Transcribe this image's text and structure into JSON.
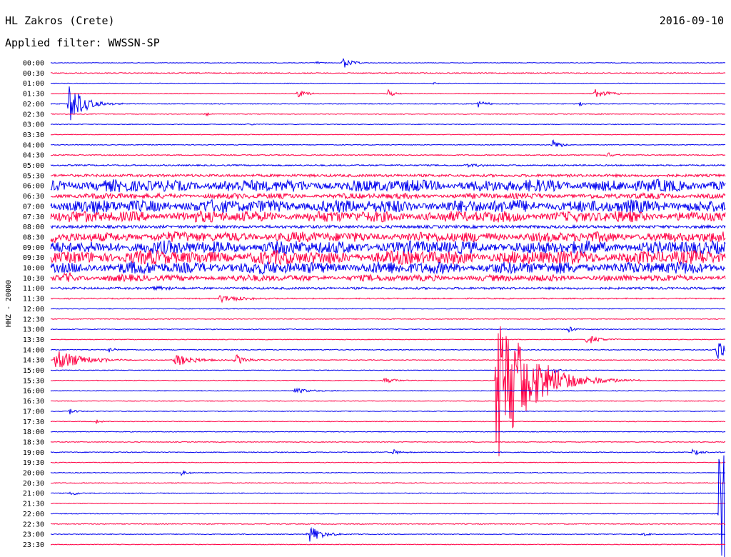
{
  "header": {
    "station": "HL Zakros (Crete)",
    "date": "2016-09-10",
    "filter": "Applied filter: WWSSN-SP"
  },
  "chart_data": {
    "type": "line",
    "title": "HL Zakros (Crete)",
    "subtitle": "Applied filter: WWSSN-SP",
    "ylabel": "HHZ - 20000",
    "colors": {
      "even_row": "#0000ee",
      "odd_row": "#ff0044"
    },
    "tick_labels": [
      "00:00",
      "00:30",
      "01:00",
      "01:30",
      "02:00",
      "02:30",
      "03:00",
      "03:30",
      "04:00",
      "04:30",
      "05:00",
      "05:30",
      "06:00",
      "06:30",
      "07:00",
      "07:30",
      "08:00",
      "08:30",
      "09:00",
      "09:30",
      "10:00",
      "10:30",
      "11:00",
      "11:30",
      "12:00",
      "12:30",
      "13:00",
      "13:30",
      "14:00",
      "14:30",
      "15:00",
      "15:30",
      "16:00",
      "16:30",
      "17:00",
      "17:30",
      "18:00",
      "18:30",
      "19:00",
      "19:30",
      "20:00",
      "20:30",
      "21:00",
      "21:30",
      "22:00",
      "22:30",
      "23:00",
      "23:30"
    ],
    "noise_level": [
      0.4,
      0.7,
      0.4,
      0.5,
      0.6,
      0.5,
      0.5,
      0.5,
      0.5,
      0.7,
      1.0,
      1.8,
      6.5,
      3.0,
      7.0,
      6.0,
      2.0,
      5.5,
      7.0,
      7.5,
      6.5,
      3.5,
      1.5,
      0.8,
      0.5,
      0.6,
      0.6,
      0.5,
      0.6,
      0.5,
      0.5,
      0.5,
      0.5,
      0.5,
      0.5,
      0.5,
      0.5,
      0.5,
      0.6,
      0.5,
      0.5,
      0.6,
      0.6,
      0.5,
      0.5,
      0.6,
      0.5,
      0.5
    ],
    "events": [
      {
        "row": 0,
        "minute": 13.0,
        "amplitude": 9,
        "duration": 0.6
      },
      {
        "row": 0,
        "minute": 11.8,
        "amplitude": 2,
        "duration": 0.5
      },
      {
        "row": 2,
        "minute": 17.0,
        "amplitude": 2,
        "duration": 0.3
      },
      {
        "row": 3,
        "minute": 11.0,
        "amplitude": 7,
        "duration": 0.5
      },
      {
        "row": 3,
        "minute": 15.0,
        "amplitude": 6,
        "duration": 0.4
      },
      {
        "row": 3,
        "minute": 24.2,
        "amplitude": 7,
        "duration": 0.9
      },
      {
        "row": 4,
        "minute": 0.8,
        "amplitude": 30,
        "duration": 1.0
      },
      {
        "row": 4,
        "minute": 19.0,
        "amplitude": 5,
        "duration": 0.6
      },
      {
        "row": 4,
        "minute": 23.5,
        "amplitude": 4,
        "duration": 0.3
      },
      {
        "row": 5,
        "minute": 6.9,
        "amplitude": 3,
        "duration": 0.3
      },
      {
        "row": 5,
        "minute": 24.5,
        "amplitude": 2,
        "duration": 0.3
      },
      {
        "row": 6,
        "minute": 8.8,
        "amplitude": 3,
        "duration": 0.3
      },
      {
        "row": 8,
        "minute": 22.3,
        "amplitude": 9,
        "duration": 0.5
      },
      {
        "row": 9,
        "minute": 24.7,
        "amplitude": 6,
        "duration": 0.5
      },
      {
        "row": 10,
        "minute": 18.5,
        "amplitude": 3,
        "duration": 0.8
      },
      {
        "row": 21,
        "minute": 0.6,
        "amplitude": 8,
        "duration": 0.8
      },
      {
        "row": 22,
        "minute": 4.5,
        "amplitude": 5,
        "duration": 0.8
      },
      {
        "row": 23,
        "minute": 7.5,
        "amplitude": 6,
        "duration": 1.5
      },
      {
        "row": 26,
        "minute": 23.0,
        "amplitude": 5,
        "duration": 0.5
      },
      {
        "row": 27,
        "minute": 23.8,
        "amplitude": 7,
        "duration": 1.0
      },
      {
        "row": 28,
        "minute": 2.6,
        "amplitude": 4,
        "duration": 0.4
      },
      {
        "row": 28,
        "minute": 29.6,
        "amplitude": 20,
        "duration": 0.8
      },
      {
        "row": 29,
        "minute": 0.2,
        "amplitude": 16,
        "duration": 1.8
      },
      {
        "row": 29,
        "minute": 5.5,
        "amplitude": 10,
        "duration": 1.3
      },
      {
        "row": 29,
        "minute": 8.2,
        "amplitude": 8,
        "duration": 0.8
      },
      {
        "row": 30,
        "minute": 22.4,
        "amplitude": 5,
        "duration": 0.5
      },
      {
        "row": 31,
        "minute": 14.8,
        "amplitude": 4,
        "duration": 1.0
      },
      {
        "row": 31,
        "minute": 19.8,
        "amplitude": 125,
        "duration": 2.2
      },
      {
        "row": 32,
        "minute": 10.8,
        "amplitude": 4,
        "duration": 1.2
      },
      {
        "row": 34,
        "minute": 0.8,
        "amplitude": 6,
        "duration": 0.4
      },
      {
        "row": 35,
        "minute": 2.0,
        "amplitude": 3,
        "duration": 0.4
      },
      {
        "row": 38,
        "minute": 15.2,
        "amplitude": 4,
        "duration": 0.6
      },
      {
        "row": 38,
        "minute": 28.5,
        "amplitude": 5,
        "duration": 0.6
      },
      {
        "row": 40,
        "minute": 5.8,
        "amplitude": 5,
        "duration": 0.4
      },
      {
        "row": 42,
        "minute": 0.9,
        "amplitude": 5,
        "duration": 0.4
      },
      {
        "row": 44,
        "minute": 29.7,
        "amplitude": 110,
        "duration": 1.5
      },
      {
        "row": 46,
        "minute": 11.4,
        "amplitude": 13,
        "duration": 1.0
      },
      {
        "row": 46,
        "minute": 26.3,
        "amplitude": 4,
        "duration": 0.4
      }
    ]
  }
}
